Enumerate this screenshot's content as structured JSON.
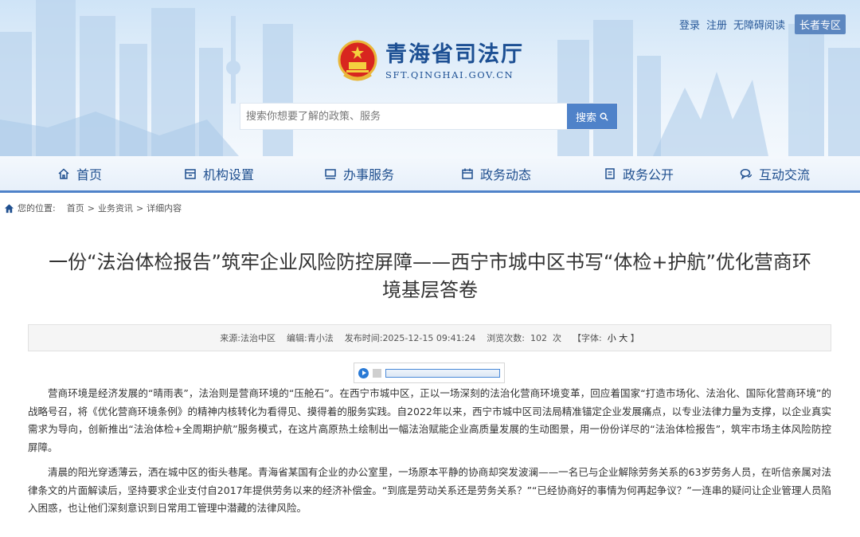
{
  "top_links": [
    "登录",
    "注册",
    "无障碍阅读"
  ],
  "elder_zone": "长者专区",
  "site": {
    "name_cn": "青海省司法厅",
    "name_en": "SFT.QINGHAI.GOV.CN"
  },
  "search": {
    "placeholder": "搜索你想要了解的政策、服务",
    "button": "搜索"
  },
  "nav": [
    {
      "label": "首页",
      "icon": "home-icon"
    },
    {
      "label": "机构设置",
      "icon": "building-icon"
    },
    {
      "label": "办事服务",
      "icon": "service-icon"
    },
    {
      "label": "政务动态",
      "icon": "calendar-icon"
    },
    {
      "label": "政务公开",
      "icon": "document-icon"
    },
    {
      "label": "互动交流",
      "icon": "chat-icon"
    }
  ],
  "breadcrumb": {
    "prefix": "您的位置:",
    "items": [
      "首页",
      "业务资讯",
      "详细内容"
    ],
    "separator": ">"
  },
  "article": {
    "title_line1": "一份“法治体检报告”筑牢企业风险防控屏障——西宁市城中区书写“体检+护航”优化营商环",
    "title_line2": "境基层答卷",
    "meta": {
      "source_label": "来源:",
      "source": "法治中区",
      "editor_label": "编辑:",
      "editor": "青小法",
      "time_label": "发布时间:",
      "time": "2025-12-15 09:41:24",
      "views_label": "浏览次数:",
      "views": "102",
      "views_unit": "次",
      "font_label": "【字体:",
      "font_small": "小",
      "font_large": "大",
      "font_close": "】"
    },
    "paragraphs": [
      "营商环境是经济发展的“晴雨表”，法治则是营商环境的“压舱石”。在西宁市城中区，正以一场深刻的法治化营商环境变革，回应着国家“打造市场化、法治化、国际化营商环境”的战略号召，将《优化营商环境条例》的精神内核转化为看得见、摸得着的服务实践。自2022年以来，西宁市城中区司法局精准锚定企业发展痛点，以专业法律力量为支撑，以企业真实需求为导向，创新推出“法治体检+全周期护航”服务模式，在这片高原热土绘制出一幅法治赋能企业高质量发展的生动图景，用一份份详尽的“法治体检报告”，筑牢市场主体风险防控屏障。",
      "清晨的阳光穿透薄云，洒在城中区的街头巷尾。青海省某国有企业的办公室里，一场原本平静的协商却突发波澜——一名已与企业解除劳务关系的63岁劳务人员，在听信亲属对法律条文的片面解读后，坚持要求企业支付自2017年提供劳务以来的经济补偿金。“到底是劳动关系还是劳务关系？”“已经协商好的事情为何再起争议？”一连串的疑问让企业管理人员陷入困惑，也让他们深刻意识到日常用工管理中潜藏的法律风险。"
    ]
  }
}
